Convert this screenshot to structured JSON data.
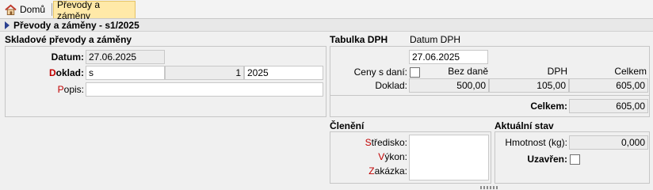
{
  "tabs": {
    "home_label": "Domů",
    "active_label": "Převody a záměny"
  },
  "header": {
    "title": "Převody a záměny - s1/2025"
  },
  "skladove": {
    "title": "Skladové převody a záměny",
    "datum_label": "Datum:",
    "datum_value": "27.06.2025",
    "doklad_label_hot": "D",
    "doklad_label_rest": "oklad:",
    "doklad_series": "s",
    "doklad_number": "1",
    "doklad_year": "2025",
    "popis_label_hot": "P",
    "popis_label_rest": "opis:",
    "popis_value": ""
  },
  "dph": {
    "title": "Tabulka DPH",
    "datum_label": "Datum DPH",
    "datum_value": "27.06.2025",
    "ceny_label": "Ceny s daní:",
    "col_bez": "Bez daně",
    "col_dph": "DPH",
    "col_celkem": "Celkem",
    "row_label": "Doklad:",
    "bez_value": "500,00",
    "dph_value": "105,00",
    "celkem_value": "605,00",
    "total_label": "Celkem:",
    "total_value": "605,00"
  },
  "cleneni": {
    "title": "Členění",
    "stredisko_hot": "S",
    "stredisko_rest": "tředisko:",
    "vykon_hot": "V",
    "vykon_rest": "ýkon:",
    "zakazka_hot": "Z",
    "zakazka_rest": "akázka:"
  },
  "stav": {
    "title": "Aktuální stav",
    "hmotnost_label": "Hmotnost (kg):",
    "hmotnost_value": "0,000",
    "uzavren_label": "Uzavřen:"
  }
}
